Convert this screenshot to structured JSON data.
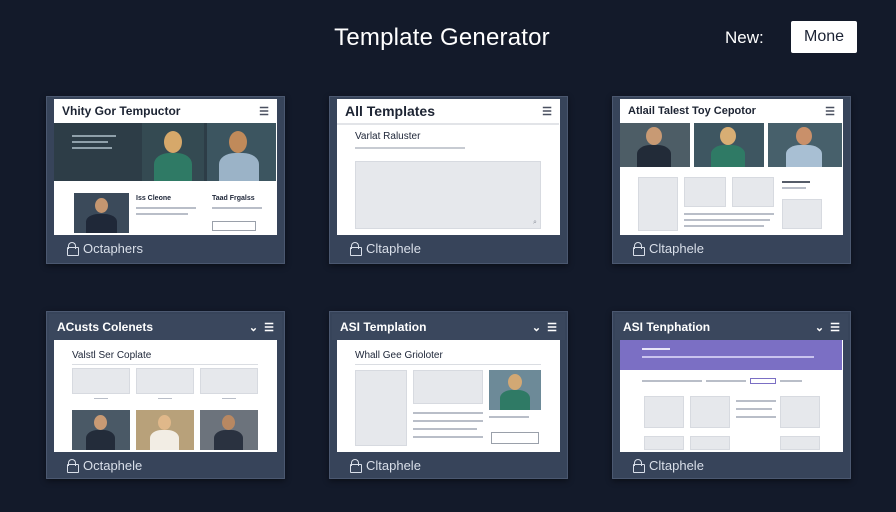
{
  "app": {
    "title": "Template Generator"
  },
  "header": {
    "new_label": "New:",
    "more_label": "Mone"
  },
  "cards": [
    {
      "title": "Vhity Gor Tempuctor",
      "sub_left": "Iss Cleone",
      "sub_right": "Taad Frgalss",
      "footer": "Octaphers"
    },
    {
      "title": "All Templates",
      "sub": "Varlat Raluster",
      "footer": "Cltaphele"
    },
    {
      "title": "Atlail Talest Toy Cepotor",
      "footer": "Cltaphele"
    },
    {
      "title": "ACusts Colenets",
      "sub": "Valstl Ser Coplate",
      "footer": "Octaphele"
    },
    {
      "title": "ASI Templation",
      "sub": "Whall Gee Grioloter",
      "footer": "Cltaphele"
    },
    {
      "title": "ASI Tenphation",
      "footer": "Cltaphele"
    }
  ],
  "icons": {
    "menu": "hamburger-menu-icon",
    "chevron": "chevron-down-icon",
    "lock": "lock-icon"
  },
  "colors": {
    "background": "#131a2a",
    "card": "#37445a",
    "banner_dark": "#2d3d47",
    "banner_purple": "#7b6fc4",
    "photo_teal": "#3c5560"
  }
}
